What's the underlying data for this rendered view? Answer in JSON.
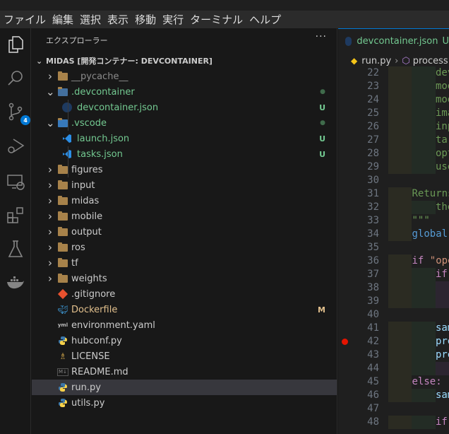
{
  "menu": [
    "ファイル",
    "編集",
    "選択",
    "表示",
    "移動",
    "実行",
    "ターミナル",
    "ヘルプ"
  ],
  "activity_badge": "4",
  "explorer": {
    "title": "エクスプローラー",
    "more": "···",
    "root": "MIDAS [開発コンテナー: DEVCONTAINER]",
    "items": [
      {
        "label": "__pycache__",
        "kind": "folder",
        "depth": 0,
        "chev": "›",
        "color": "#8b8b8b"
      },
      {
        "label": ".devcontainer",
        "kind": "folder-dev",
        "depth": 0,
        "chev": "⌄",
        "color": "#73c991",
        "status": "●",
        "status_color": "#3f6b4b"
      },
      {
        "label": "devcontainer.json",
        "kind": "devjson",
        "depth": 1,
        "color": "#73c991",
        "status": "U",
        "status_color": "#73c991"
      },
      {
        "label": ".vscode",
        "kind": "folder-vs",
        "depth": 0,
        "chev": "⌄",
        "color": "#73c991",
        "status": "●",
        "status_color": "#3f6b4b"
      },
      {
        "label": "launch.json",
        "kind": "vscode",
        "depth": 1,
        "color": "#73c991",
        "status": "U",
        "status_color": "#73c991"
      },
      {
        "label": "tasks.json",
        "kind": "vscode",
        "depth": 1,
        "color": "#73c991",
        "status": "U",
        "status_color": "#73c991"
      },
      {
        "label": "figures",
        "kind": "folder",
        "depth": 0,
        "chev": "›"
      },
      {
        "label": "input",
        "kind": "folder",
        "depth": 0,
        "chev": "›"
      },
      {
        "label": "midas",
        "kind": "folder",
        "depth": 0,
        "chev": "›"
      },
      {
        "label": "mobile",
        "kind": "folder",
        "depth": 0,
        "chev": "›"
      },
      {
        "label": "output",
        "kind": "folder",
        "depth": 0,
        "chev": "›"
      },
      {
        "label": "ros",
        "kind": "folder",
        "depth": 0,
        "chev": "›"
      },
      {
        "label": "tf",
        "kind": "folder",
        "depth": 0,
        "chev": "›"
      },
      {
        "label": "weights",
        "kind": "folder",
        "depth": 0,
        "chev": "›"
      },
      {
        "label": ".gitignore",
        "kind": "git",
        "depth": 0
      },
      {
        "label": "Dockerfile",
        "kind": "docker",
        "depth": 0,
        "color": "#e2c08d",
        "status": "M",
        "status_color": "#e2c08d"
      },
      {
        "label": "environment.yaml",
        "kind": "yaml",
        "depth": 0
      },
      {
        "label": "hubconf.py",
        "kind": "python",
        "depth": 0
      },
      {
        "label": "LICENSE",
        "kind": "license",
        "depth": 0
      },
      {
        "label": "README.md",
        "kind": "md",
        "depth": 0
      },
      {
        "label": "run.py",
        "kind": "python",
        "depth": 0,
        "selected": true
      },
      {
        "label": "utils.py",
        "kind": "python",
        "depth": 0
      }
    ]
  },
  "editor": {
    "tab": {
      "label": "devcontainer.json",
      "status": "U"
    },
    "breadcrumb": {
      "file": "run.py",
      "sep": "›",
      "symbol": "process"
    },
    "lines": [
      {
        "n": "22",
        "indent": 2,
        "text": "dev",
        "c": "#6a9955",
        "g": [
          1,
          2
        ]
      },
      {
        "n": "23",
        "indent": 2,
        "text": "mod",
        "c": "#6a9955",
        "g": [
          1,
          2
        ]
      },
      {
        "n": "24",
        "indent": 2,
        "text": "mod",
        "c": "#6a9955",
        "g": [
          1,
          2
        ]
      },
      {
        "n": "25",
        "indent": 2,
        "text": "ima",
        "c": "#6a9955",
        "g": [
          1,
          2
        ]
      },
      {
        "n": "26",
        "indent": 2,
        "text": "inp",
        "c": "#6a9955",
        "g": [
          1,
          2
        ]
      },
      {
        "n": "27",
        "indent": 2,
        "text": "tar",
        "c": "#6a9955",
        "g": [
          1,
          2
        ]
      },
      {
        "n": "28",
        "indent": 2,
        "text": "opt",
        "c": "#6a9955",
        "g": [
          1,
          2
        ]
      },
      {
        "n": "29",
        "indent": 2,
        "text": "use",
        "c": "#6a9955",
        "g": [
          1,
          2
        ]
      },
      {
        "n": "30",
        "indent": 0,
        "text": "",
        "c": "#ccc",
        "g": []
      },
      {
        "n": "31",
        "indent": 1,
        "text": "Returns",
        "c": "#6a9955",
        "g": [
          1
        ]
      },
      {
        "n": "32",
        "indent": 2,
        "text": "the",
        "c": "#6a9955",
        "g": [
          1,
          2
        ]
      },
      {
        "n": "33",
        "indent": 1,
        "text": "\"\"\"",
        "c": "#6a9955",
        "g": [
          1
        ]
      },
      {
        "n": "34",
        "indent": 1,
        "text": "global",
        "c": "#569cd6",
        "g": [
          1
        ]
      },
      {
        "n": "35",
        "indent": 0,
        "text": "",
        "c": "#ccc",
        "g": []
      },
      {
        "n": "36",
        "indent": 1,
        "text": "if \"ope",
        "c": "#c586c0",
        "g": [
          1
        ]
      },
      {
        "n": "37",
        "indent": 2,
        "text": "if",
        "c": "#c586c0",
        "g": [
          1,
          2
        ]
      },
      {
        "n": "38",
        "indent": 0,
        "text": "",
        "c": "#ccc",
        "g": [
          1,
          2,
          3
        ]
      },
      {
        "n": "39",
        "indent": 0,
        "text": "",
        "c": "#ccc",
        "g": [
          1,
          2,
          3
        ]
      },
      {
        "n": "40",
        "indent": 0,
        "text": "",
        "c": "#ccc",
        "g": []
      },
      {
        "n": "41",
        "indent": 2,
        "text": "sam",
        "c": "#9cdcfe",
        "g": [
          1,
          2
        ]
      },
      {
        "n": "42",
        "indent": 2,
        "text": "pre",
        "c": "#9cdcfe",
        "g": [
          1,
          2
        ],
        "breakpoint": true
      },
      {
        "n": "43",
        "indent": 2,
        "text": "pre",
        "c": "#9cdcfe",
        "g": [
          1,
          2
        ]
      },
      {
        "n": "44",
        "indent": 0,
        "text": "",
        "c": "#ccc",
        "g": [
          1,
          2,
          3
        ]
      },
      {
        "n": "45",
        "indent": 1,
        "text": "else:",
        "c": "#c586c0",
        "g": [
          1
        ]
      },
      {
        "n": "46",
        "indent": 2,
        "text": "sam",
        "c": "#9cdcfe",
        "g": [
          1,
          2
        ]
      },
      {
        "n": "47",
        "indent": 0,
        "text": "",
        "c": "#ccc",
        "g": []
      },
      {
        "n": "48",
        "indent": 2,
        "text": "if",
        "c": "#c586c0",
        "g": [
          1,
          2
        ]
      }
    ]
  }
}
